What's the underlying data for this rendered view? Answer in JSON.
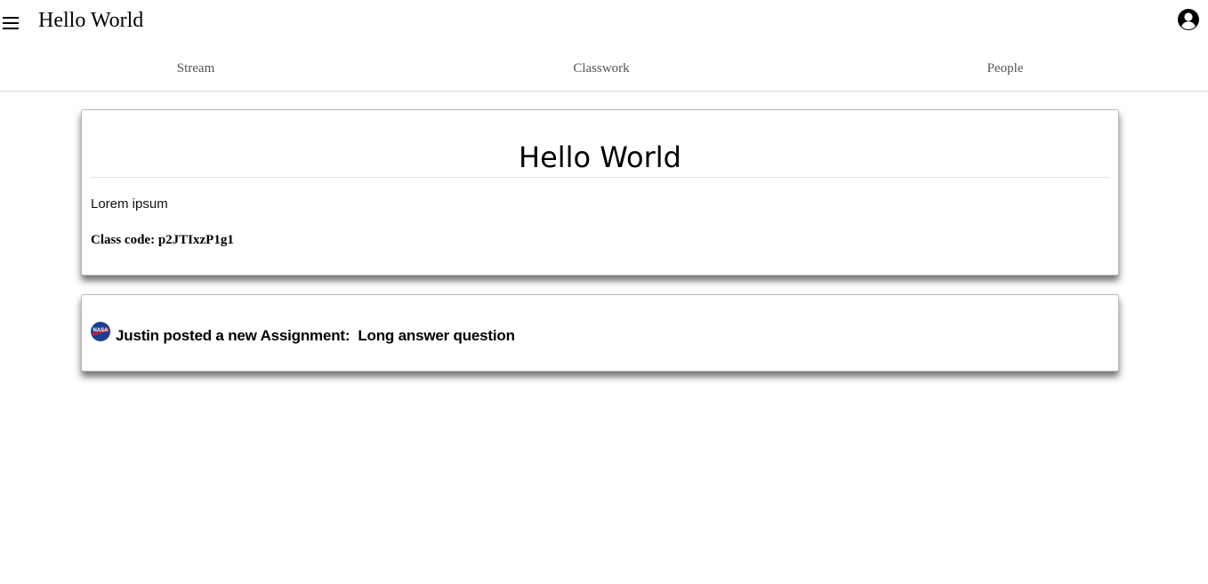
{
  "header": {
    "app_title": "Hello World",
    "menu_icon": "hamburger-menu-icon",
    "account_icon": "account-circle-icon"
  },
  "tabs": [
    {
      "label": "Stream"
    },
    {
      "label": "Classwork"
    },
    {
      "label": "People"
    }
  ],
  "class_card": {
    "title": "Hello World",
    "description": "Lorem ipsum",
    "class_code": "Class code: p2JTIxzP1g1"
  },
  "posts": [
    {
      "avatar_icon": "nasa-logo-avatar",
      "avatar_text": "NASA",
      "text": "Justin posted a new Assignment:  Long answer question"
    }
  ],
  "colors": {
    "avatar_blue": "#1d3f8f",
    "avatar_red": "#d3202f",
    "tab_text": "#555555",
    "divider": "#d6d6d6"
  }
}
